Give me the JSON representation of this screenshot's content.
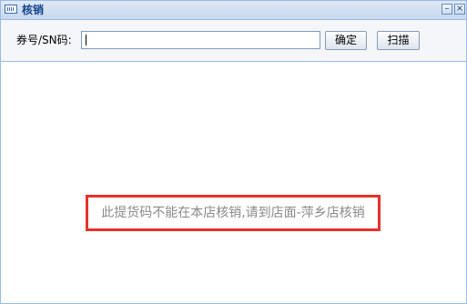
{
  "window": {
    "title": "核销",
    "minimize_glyph": "–",
    "close_glyph": "×",
    "title_icon": "ticket-icon"
  },
  "toolbar": {
    "code_label": "券号/SN码:",
    "code_value": "",
    "confirm_label": "确定",
    "scan_label": "扫描"
  },
  "content": {
    "message": "此提货码不能在本店核销,请到店面-萍乡店核销"
  },
  "colors": {
    "title_text": "#15428b",
    "border": "#99bbe8",
    "alert_border": "#e5322d",
    "message_text": "#8a8a8a"
  }
}
